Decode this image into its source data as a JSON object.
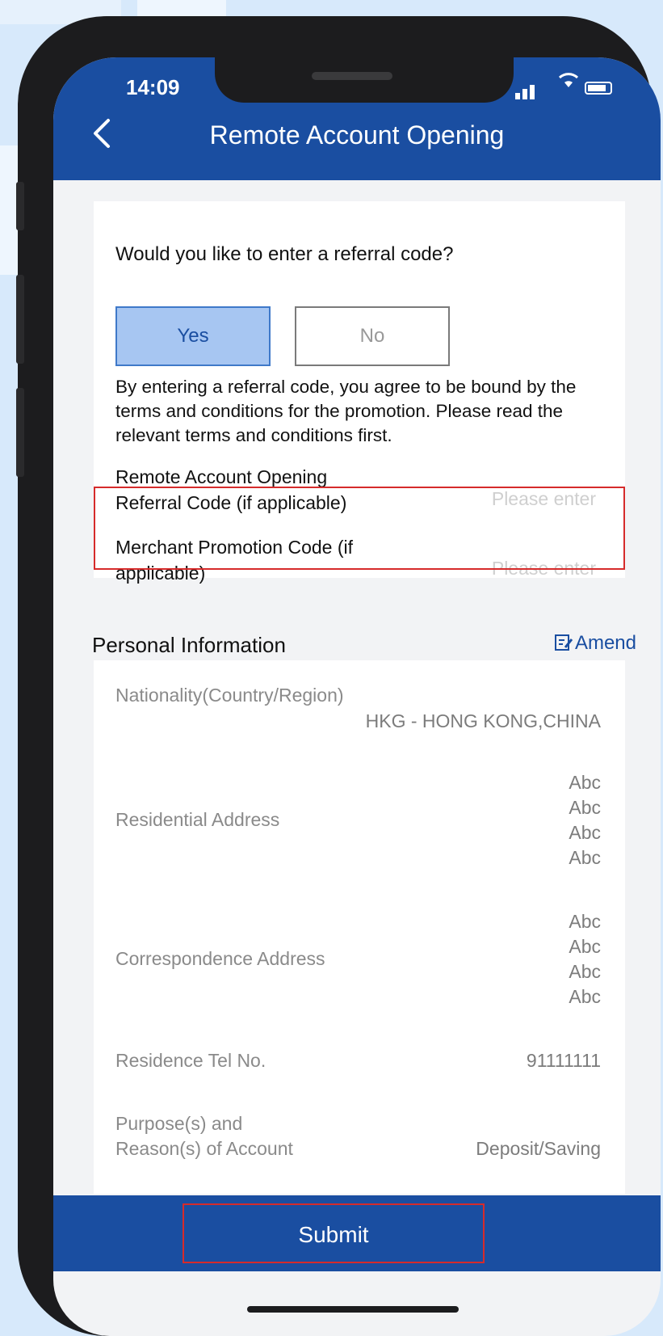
{
  "status_bar": {
    "time": "14:09"
  },
  "header": {
    "title": "Remote Account Opening"
  },
  "referral": {
    "question": "Would you like to enter a referral code?",
    "yes_label": "Yes",
    "no_label": "No",
    "terms": "By entering a referral code, you agree to be bound by the terms and conditions for the promotion. Please read the relevant terms and conditions first.",
    "referral_field": {
      "label_line1": "Remote Account Opening",
      "label_line2": "Referral Code (if applicable)",
      "placeholder": "Please enter"
    },
    "merchant_field": {
      "label_line1": "Merchant Promotion Code (if",
      "label_line2": "applicable)",
      "placeholder": "Please enter"
    }
  },
  "personal_info": {
    "title": "Personal Information",
    "amend_label": "Amend",
    "nationality": {
      "label": "Nationality(Country/Region)",
      "value": "HKG - HONG KONG,CHINA"
    },
    "residential_address": {
      "label": "Residential Address",
      "lines": [
        "Abc",
        "Abc",
        "Abc",
        "Abc"
      ]
    },
    "correspondence_address": {
      "label": "Correspondence Address",
      "lines": [
        "Abc",
        "Abc",
        "Abc",
        "Abc"
      ]
    },
    "residence_tel": {
      "label": "Residence Tel No.",
      "value": "91111111"
    },
    "purpose": {
      "label_line1": "Purpose(s) and",
      "label_line2": "Reason(s) of Account",
      "value": "Deposit/Saving"
    }
  },
  "footer": {
    "submit_label": "Submit"
  },
  "colors": {
    "brand_blue": "#1a4ea1",
    "selected_fill": "#a7c6f2",
    "highlight_red": "#d62b2b"
  }
}
